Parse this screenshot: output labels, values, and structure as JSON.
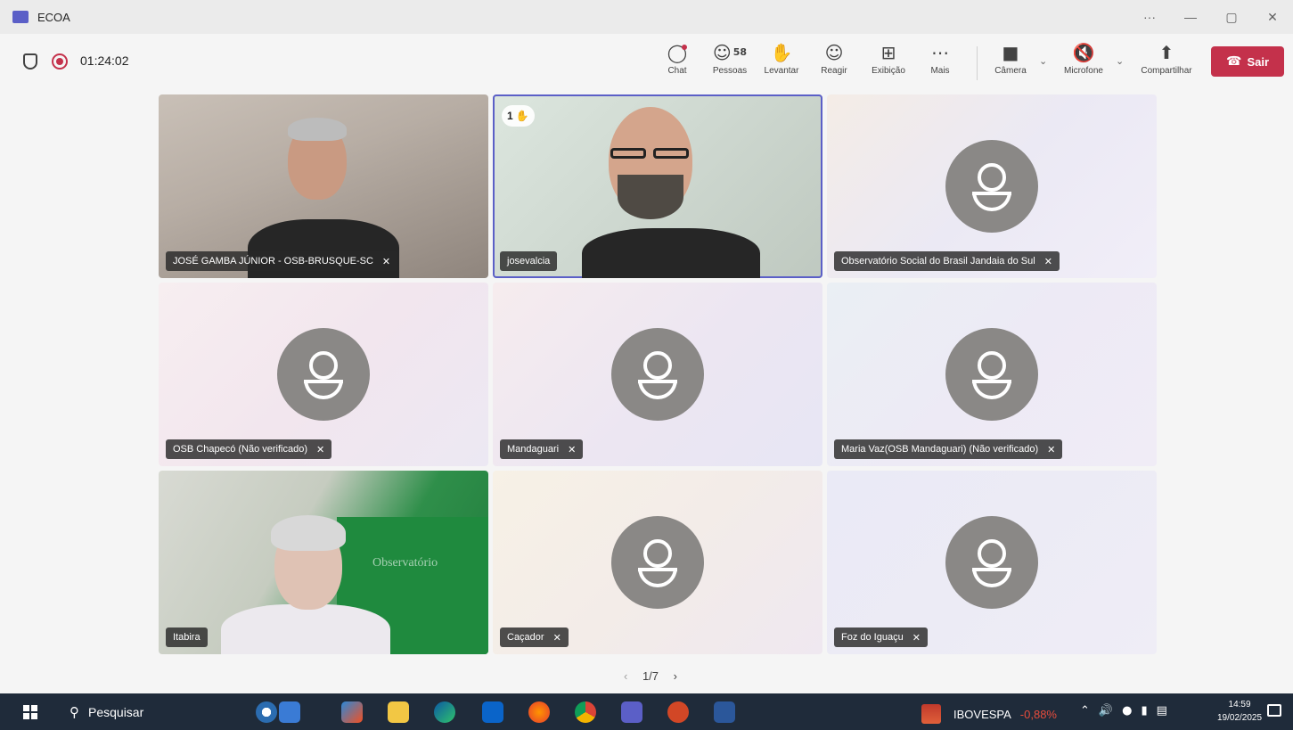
{
  "window": {
    "title": "ECOA",
    "controls": [
      "···",
      "—",
      "▢",
      "✕"
    ]
  },
  "meeting": {
    "timer": "01:24:02",
    "toolbar": {
      "chat": "Chat",
      "people": "Pessoas",
      "people_count": "58",
      "raise": "Levantar",
      "react": "Reagir",
      "view": "Exibição",
      "more": "Mais",
      "camera": "Câmera",
      "microphone": "Microfone",
      "share": "Compartilhar",
      "leave": "Sair"
    }
  },
  "participants": [
    {
      "name": "JOSÉ GAMBA JÚNIOR - OSB-BRUSQUE-SC",
      "muted": true,
      "video": true
    },
    {
      "name": "josevalcia",
      "muted": false,
      "video": true,
      "hand_raised": "1",
      "speaking": true
    },
    {
      "name": "Observatório Social do Brasil Jandaia do Sul",
      "muted": true,
      "video": false
    },
    {
      "name": "OSB Chapecó (Não verificado)",
      "muted": true,
      "video": false
    },
    {
      "name": "Mandaguari",
      "muted": true,
      "video": false
    },
    {
      "name": "Maria Vaz(OSB Mandaguari) (Não verificado)",
      "muted": true,
      "video": false
    },
    {
      "name": "Itabira",
      "muted": false,
      "video": true,
      "backdrop_text": "Observatório"
    },
    {
      "name": "Caçador",
      "muted": true,
      "video": false
    },
    {
      "name": "Foz do Iguaçu",
      "muted": true,
      "video": false
    }
  ],
  "pager": {
    "label": "1/7"
  },
  "taskbar": {
    "search_placeholder": "Pesquisar",
    "ticker_name": "IBOVESPA",
    "ticker_change": "-0,88%",
    "time": "14:59",
    "date": "19/02/2025"
  },
  "colors": {
    "accent": "#5b5fc7",
    "leave": "#c4314b",
    "taskbar": "#1f2b3a",
    "negative": "#e74c3c"
  }
}
